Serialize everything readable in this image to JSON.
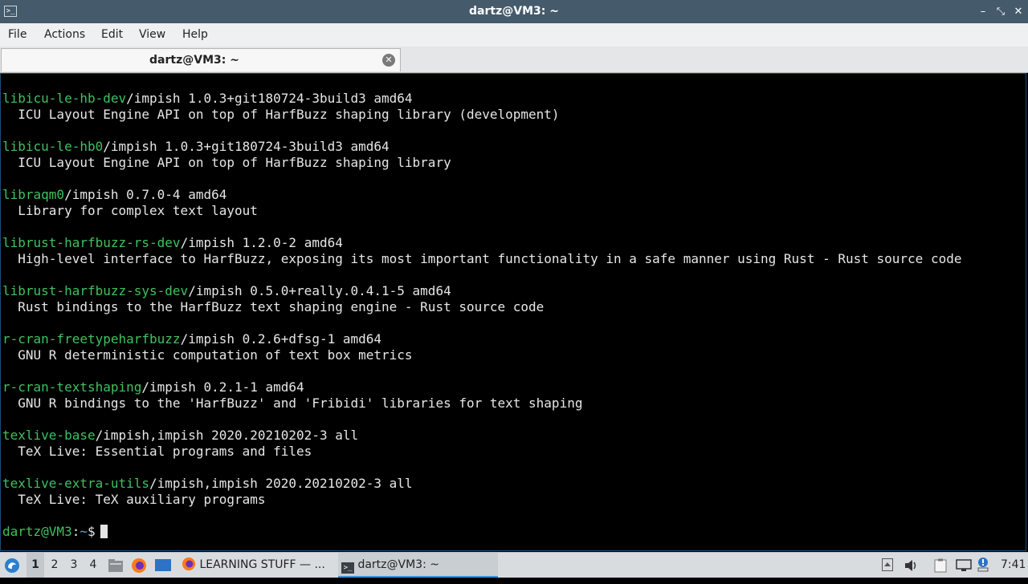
{
  "window": {
    "title": "dartz@VM3: ~",
    "app_icon": ">_",
    "controls": [
      "–",
      "⤡",
      "✕"
    ]
  },
  "menu": [
    "File",
    "Actions",
    "Edit",
    "View",
    "Help"
  ],
  "tab": {
    "label": "dartz@VM3: ~",
    "close": "✕"
  },
  "terminal": {
    "lines": [
      {
        "pkg": "libicu-le-hb-dev",
        "rest": "/impish 1.0.3+git180724-3build3 amd64"
      },
      {
        "pkg": "",
        "rest": "  ICU Layout Engine API on top of HarfBuzz shaping library (development)"
      },
      {
        "pkg": "",
        "rest": ""
      },
      {
        "pkg": "libicu-le-hb0",
        "rest": "/impish 1.0.3+git180724-3build3 amd64"
      },
      {
        "pkg": "",
        "rest": "  ICU Layout Engine API on top of HarfBuzz shaping library"
      },
      {
        "pkg": "",
        "rest": ""
      },
      {
        "pkg": "libraqm0",
        "rest": "/impish 0.7.0-4 amd64"
      },
      {
        "pkg": "",
        "rest": "  Library for complex text layout"
      },
      {
        "pkg": "",
        "rest": ""
      },
      {
        "pkg": "librust-harfbuzz-rs-dev",
        "rest": "/impish 1.2.0-2 amd64"
      },
      {
        "pkg": "",
        "rest": "  High-level interface to HarfBuzz, exposing its most important functionality in a safe manner using Rust - Rust source code"
      },
      {
        "pkg": "",
        "rest": ""
      },
      {
        "pkg": "librust-harfbuzz-sys-dev",
        "rest": "/impish 0.5.0+really.0.4.1-5 amd64"
      },
      {
        "pkg": "",
        "rest": "  Rust bindings to the HarfBuzz text shaping engine - Rust source code"
      },
      {
        "pkg": "",
        "rest": ""
      },
      {
        "pkg": "r-cran-freetypeharfbuzz",
        "rest": "/impish 0.2.6+dfsg-1 amd64"
      },
      {
        "pkg": "",
        "rest": "  GNU R deterministic computation of text box metrics"
      },
      {
        "pkg": "",
        "rest": ""
      },
      {
        "pkg": "r-cran-textshaping",
        "rest": "/impish 0.2.1-1 amd64"
      },
      {
        "pkg": "",
        "rest": "  GNU R bindings to the 'HarfBuzz' and 'Fribidi' libraries for text shaping"
      },
      {
        "pkg": "",
        "rest": ""
      },
      {
        "pkg": "texlive-base",
        "rest": "/impish,impish 2020.20210202-3 all"
      },
      {
        "pkg": "",
        "rest": "  TeX Live: Essential programs and files"
      },
      {
        "pkg": "",
        "rest": ""
      },
      {
        "pkg": "texlive-extra-utils",
        "rest": "/impish,impish 2020.20210202-3 all"
      },
      {
        "pkg": "",
        "rest": "  TeX Live: TeX auxiliary programs"
      },
      {
        "pkg": "",
        "rest": ""
      }
    ],
    "prompt": {
      "user": "dartz@VM3",
      "sep": ":",
      "path": "~",
      "symbol": "$"
    }
  },
  "taskbar": {
    "workspaces": [
      "1",
      "2",
      "3",
      "4"
    ],
    "active_workspace": "1",
    "tasks": [
      {
        "label": "LEARNING STUFF — ...",
        "icon": "firefox-icon"
      },
      {
        "label": "dartz@VM3: ~",
        "icon": "terminal-icon",
        "active": true
      }
    ],
    "clock": "7:41",
    "colors": {
      "accent": "#3b8fd8",
      "prompt": "#3fc15f",
      "path": "#5aa0ff"
    }
  }
}
